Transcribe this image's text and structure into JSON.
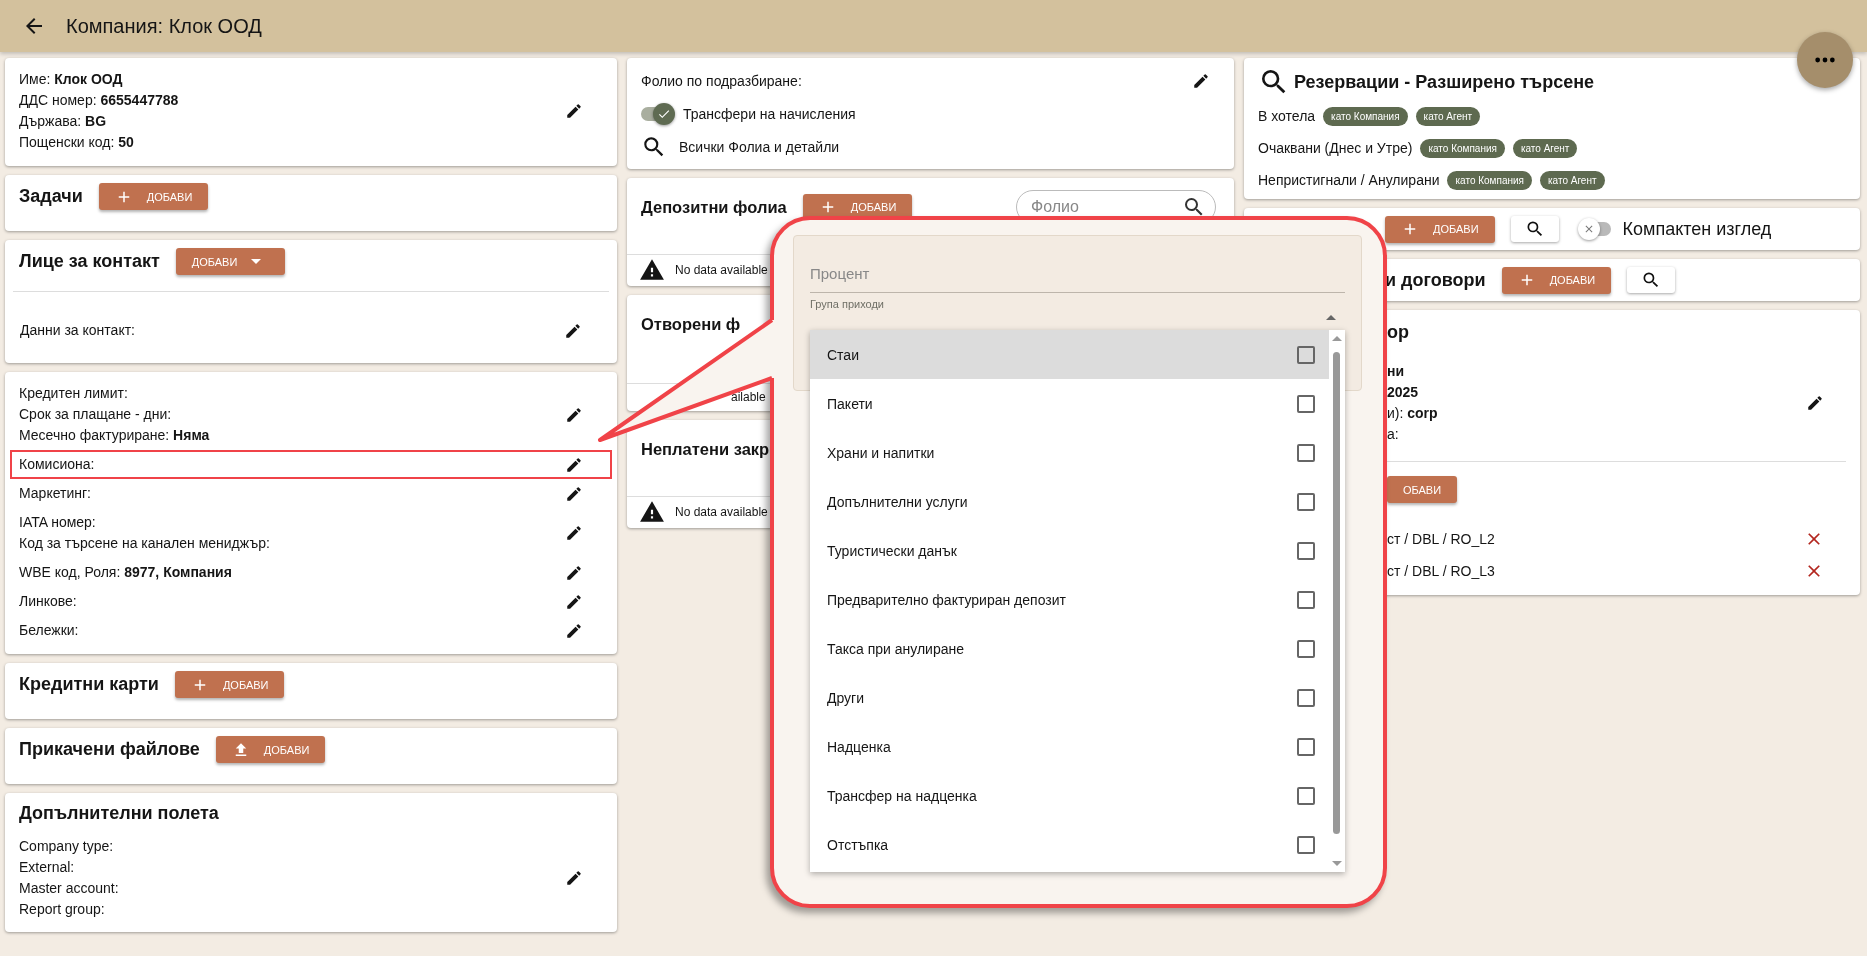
{
  "header": {
    "title": "Компания: Клок ООД"
  },
  "left_cards": [
    {
      "kind": "details",
      "groups": [
        {
          "lines": [
            "Име: **Клок ООД**",
            "ДДС номер: **6655447788**",
            "Държава: **BG**",
            "Пощенски код: **50**"
          ],
          "highlighted": false
        }
      ]
    },
    {
      "kind": "heading",
      "title": "Задачи",
      "button": {
        "label": "ДОБАВИ",
        "kind": "add"
      }
    },
    {
      "kind": "contact",
      "title": "Лице за контакт",
      "button": {
        "label": "ДОБАВИ",
        "kind": "menu"
      },
      "groups": [
        {
          "lines": [
            "Данни за контакт:"
          ],
          "highlighted": false
        }
      ]
    },
    {
      "kind": "details",
      "groups": [
        {
          "lines": [
            "Кредитен лимит:",
            "Срок за плащане - дни:",
            "Месечно фактуриране: **Няма**"
          ],
          "highlighted": false
        },
        {
          "lines": [
            "Комисиона:"
          ],
          "highlighted": true
        },
        {
          "lines": [
            "Маркетинг:"
          ],
          "highlighted": false
        },
        {
          "lines": [
            "IATA номер:",
            "Код за търсене на канален мениджър:"
          ],
          "highlighted": false
        },
        {
          "lines": [
            "WBE код, Роля: **8977, Компания**"
          ],
          "highlighted": false
        },
        {
          "lines": [
            "Линкове:"
          ],
          "highlighted": false
        },
        {
          "lines": [
            "Бележки:"
          ],
          "highlighted": false
        }
      ]
    },
    {
      "kind": "heading",
      "title": "Кредитни карти",
      "button": {
        "label": "ДОБАВИ",
        "kind": "add"
      }
    },
    {
      "kind": "heading",
      "title": "Прикачени файлове",
      "button": {
        "label": "ДОБАВИ",
        "kind": "upload"
      }
    },
    {
      "kind": "fields",
      "title": "Допълнителни полета",
      "groups": [
        {
          "lines": [
            "Company type:",
            "External:",
            "Master account:",
            "Report group:"
          ],
          "highlighted": false
        }
      ]
    }
  ],
  "middle_cards": [
    {
      "kind": "folio",
      "label": "Фолио по подразбиране:",
      "toggle": {
        "label": "Трансфери на начисления",
        "on": true
      },
      "link": "Всички Фолиа и детайли"
    },
    {
      "kind": "table",
      "title": "Депозитни фолиа",
      "button": {
        "label": "ДОБАВИ",
        "kind": "add"
      },
      "search": {
        "placeholder": "Фолио"
      },
      "empty": "No data available"
    },
    {
      "kind": "table_cut",
      "title": "Отворени ф",
      "empty": "ailable"
    },
    {
      "kind": "table",
      "title": "Неплатени закр",
      "empty": "No data available"
    }
  ],
  "right_cards": [
    {
      "kind": "search_panel",
      "title": "Резервации - Разширено търсене",
      "rows": [
        {
          "label": "В хотела",
          "chips": [
            "като Компания",
            "като Агент"
          ]
        },
        {
          "label": "Очаквани (Днес и Утре)",
          "chips": [
            "като Компания",
            "като Агент"
          ]
        },
        {
          "label": "Непристигнали / Анулирани",
          "chips": [
            "като Компания",
            "като Агент"
          ]
        }
      ]
    },
    {
      "kind": "toolbar",
      "button": {
        "label": "ДОБАВИ",
        "kind": "add"
      },
      "toggle": {
        "label": "Компактен изглед",
        "on": false
      }
    },
    {
      "kind": "toolbar",
      "title": "и договори",
      "button": {
        "label": "ДОБАВИ",
        "kind": "add"
      }
    },
    {
      "kind": "contract",
      "title": "ор",
      "lines": [
        "**ни**",
        "**2025**",
        "и): **corp**",
        "а:"
      ],
      "button": {
        "label": "ОБАВИ"
      },
      "items": [
        "ст / DBL / RO_L2",
        "ст / DBL / RO_L3"
      ]
    }
  ],
  "callout": {
    "field": {
      "label": "Процент"
    },
    "select": {
      "label": "Група приходи",
      "expanded": true,
      "options": [
        {
          "label": "Стаи",
          "highlighted": true,
          "checked": false
        },
        {
          "label": "Пакети",
          "highlighted": false,
          "checked": false
        },
        {
          "label": "Храни и напитки",
          "highlighted": false,
          "checked": false
        },
        {
          "label": "Допълнителни услуги",
          "highlighted": false,
          "checked": false
        },
        {
          "label": "Туристически данък",
          "highlighted": false,
          "checked": false
        },
        {
          "label": "Предварително фактуриран депозит",
          "highlighted": false,
          "checked": false
        },
        {
          "label": "Такса при анулиране",
          "highlighted": false,
          "checked": false
        },
        {
          "label": "Други",
          "highlighted": false,
          "checked": false
        },
        {
          "label": "Надценка",
          "highlighted": false,
          "checked": false
        },
        {
          "label": "Трансфер на надценка",
          "highlighted": false,
          "checked": false
        },
        {
          "label": "Отстъпка",
          "highlighted": false,
          "checked": false
        }
      ]
    }
  }
}
